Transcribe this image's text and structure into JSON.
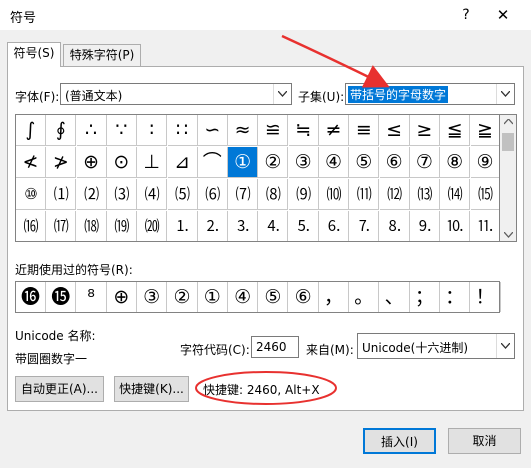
{
  "window": {
    "title": "符号",
    "help": "?",
    "close": "✕"
  },
  "tabs": [
    {
      "label": "符号(S)"
    },
    {
      "label": "特殊字符(P)"
    }
  ],
  "font": {
    "label": "字体(F):",
    "value": "(普通文本)"
  },
  "subset": {
    "label": "子集(U):",
    "value": "带括号的字母数字"
  },
  "grid": {
    "rows": [
      [
        "∫",
        "∮",
        "∴",
        "∵",
        "∶",
        "∷",
        "∽",
        "≈",
        "≌",
        "≒",
        "≠",
        "≡",
        "≤",
        "≥",
        "≦",
        "≧"
      ],
      [
        "≮",
        "≯",
        "⊕",
        "⊙",
        "⊥",
        "⊿",
        "⌒",
        "①",
        "②",
        "③",
        "④",
        "⑤",
        "⑥",
        "⑦",
        "⑧",
        "⑨"
      ],
      [
        "⑩",
        "⑴",
        "⑵",
        "⑶",
        "⑷",
        "⑸",
        "⑹",
        "⑺",
        "⑻",
        "⑼",
        "⑽",
        "⑾",
        "⑿",
        "⒀",
        "⒁",
        "⒂"
      ],
      [
        "⒃",
        "⒄",
        "⒅",
        "⒆",
        "⒇",
        "⒈",
        "⒉",
        "⒊",
        "⒋",
        "⒌",
        "⒍",
        "⒎",
        "⒏",
        "⒐",
        "⒑",
        "⒒"
      ]
    ],
    "selected": "①"
  },
  "recent": {
    "label": "近期使用过的符号(R):",
    "symbols": [
      "⓰",
      "⓯",
      "⁸",
      "⊕",
      "③",
      "②",
      "①",
      "④",
      "⑤",
      "⑥",
      "，",
      "。",
      "、",
      "；",
      "：",
      "！"
    ]
  },
  "unicode_name_label": "Unicode 名称:",
  "char_name": "带圆圈数字一",
  "code": {
    "label": "字符代码(C):",
    "value": "2460"
  },
  "from": {
    "label": "来自(M):",
    "value": "Unicode(十六进制)"
  },
  "buttons": {
    "autocorrect": "自动更正(A)...",
    "shortcut": "快捷键(K)...",
    "insert": "插入(I)",
    "cancel": "取消"
  },
  "shortcut_text": "快捷键: 2460, Alt+X",
  "colors": {
    "selection": "#0078d7",
    "annotation": "#e8312f"
  }
}
